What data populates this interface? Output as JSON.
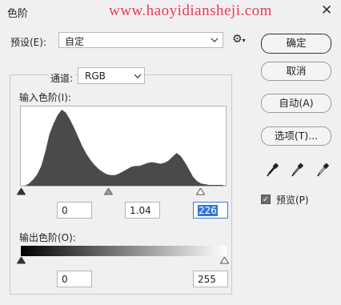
{
  "window": {
    "title": "色阶",
    "watermark": "www.haoyidiansheji.com",
    "close_glyph": "✕"
  },
  "preset": {
    "label": "预设(E):",
    "value": "自定",
    "gear_glyph": "⚙"
  },
  "channel": {
    "label": "通道:",
    "value": "RGB"
  },
  "input_levels": {
    "label": "输入色阶(I):",
    "black": "0",
    "gamma": "1.04",
    "white": "226"
  },
  "output_levels": {
    "label": "输出色阶(O):",
    "black": "0",
    "white": "255"
  },
  "buttons": {
    "ok": "确定",
    "cancel": "取消",
    "auto": "自动(A)",
    "options": "选项(T)..."
  },
  "preview": {
    "label": "预览(P)",
    "checked": true,
    "check_glyph": "✓"
  },
  "histogram": {
    "fill": "#4a4a4a",
    "levels": [
      0,
      0,
      0.03,
      0.08,
      0.15,
      0.26,
      0.45,
      0.68,
      0.82,
      0.93,
      1.0,
      0.96,
      0.87,
      0.76,
      0.64,
      0.52,
      0.42,
      0.34,
      0.27,
      0.22,
      0.18,
      0.15,
      0.14,
      0.14,
      0.16,
      0.19,
      0.22,
      0.25,
      0.26,
      0.26,
      0.28,
      0.3,
      0.31,
      0.3,
      0.29,
      0.3,
      0.33,
      0.38,
      0.43,
      0.39,
      0.31,
      0.22,
      0.12,
      0.06,
      0.03,
      0.02,
      0.01,
      0.01,
      0.01,
      0.01,
      0
    ]
  }
}
